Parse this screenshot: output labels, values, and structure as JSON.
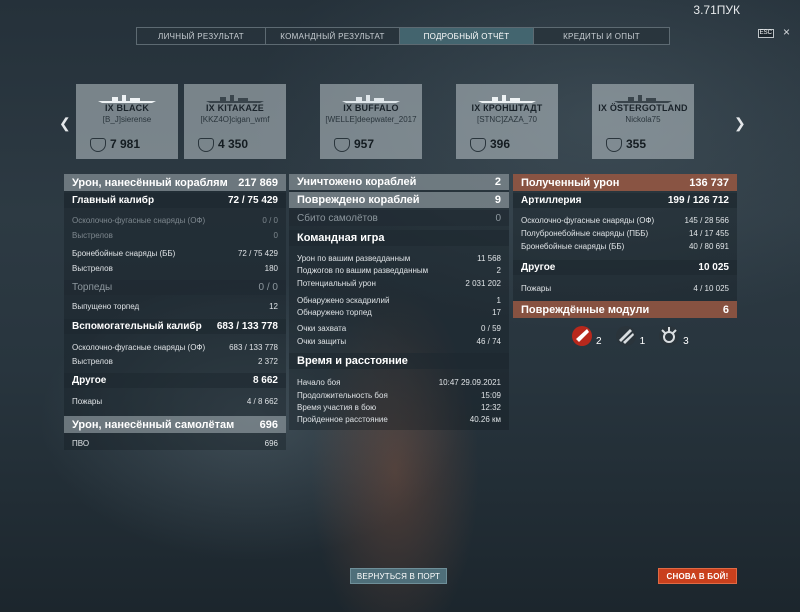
{
  "top_value": "3.71ПУК",
  "tabs": [
    {
      "label": "ЛИЧНЫЙ РЕЗУЛЬТАТ",
      "active": false
    },
    {
      "label": "КОМАНДНЫЙ РЕЗУЛЬТАТ",
      "active": false
    },
    {
      "label": "ПОДРОБНЫЙ ОТЧЁТ",
      "active": true
    },
    {
      "label": "КРЕДИТЫ И ОПЫТ",
      "active": false
    }
  ],
  "esc_label": "ESC",
  "close_symbol": "×",
  "ships": [
    {
      "name": "IX BLACK",
      "player": "[B_J]sierense",
      "score": "7 981"
    },
    {
      "name": "IX KITAKAZE",
      "player": "[KKZ4O]cigan_wmf",
      "score": "4 350"
    },
    {
      "name": "IX BUFFALO",
      "player": "[WELLE]deepwater_2017",
      "score": "957"
    },
    {
      "name": "IX КРОНШТАДТ",
      "player": "[STNC]ZAZA_70",
      "score": "396"
    },
    {
      "name": "IX ÖSTERGOTLAND",
      "player": "Nickola75",
      "score": "355"
    }
  ],
  "left": {
    "damage_ships": {
      "label": "Урон, нанесённый кораблям",
      "value": "217 869"
    },
    "main_caliber": {
      "label": "Главный калибр",
      "value": "72 / 75 429"
    },
    "he_shells": {
      "label": "Осколочно-фугасные снаряды (ОФ)",
      "value": "0 / 0"
    },
    "he_shots": {
      "label": "Выстрелов",
      "value": "0"
    },
    "ap_shells": {
      "label": "Бронебойные снаряды (ББ)",
      "value": "72 / 75 429"
    },
    "ap_shots": {
      "label": "Выстрелов",
      "value": "180"
    },
    "torpedoes": {
      "label": "Торпеды",
      "value": "0 / 0"
    },
    "torpedoes_fired": {
      "label": "Выпущено торпед",
      "value": "12"
    },
    "secondary": {
      "label": "Вспомогательный калибр",
      "value": "683 / 133 778"
    },
    "sec_he": {
      "label": "Осколочно-фугасные снаряды (ОФ)",
      "value": "683 / 133 778"
    },
    "sec_shots": {
      "label": "Выстрелов",
      "value": "2 372"
    },
    "other": {
      "label": "Другое",
      "value": "8 662"
    },
    "fires": {
      "label": "Пожары",
      "value": "4 / 8 662"
    },
    "damage_planes": {
      "label": "Урон, нанесённый самолётам",
      "value": "696"
    },
    "aa": {
      "label": "ПВО",
      "value": "696"
    }
  },
  "middle": {
    "destroyed": {
      "label": "Уничтожено кораблей",
      "value": "2"
    },
    "damaged": {
      "label": "Повреждено кораблей",
      "value": "9"
    },
    "planes": {
      "label": "Сбито самолётов",
      "value": "0"
    },
    "team_header": "Командная игра",
    "team_rows": [
      {
        "label": "Урон по вашим разведданным",
        "value": "11 568"
      },
      {
        "label": "Поджогов по вашим разведданным",
        "value": "2"
      },
      {
        "label": "Потенциальный урон",
        "value": "2 031 202"
      },
      {
        "label": "Обнаружено эскадрилий",
        "value": "1"
      },
      {
        "label": "Обнаружено торпед",
        "value": "17"
      },
      {
        "label": "Очки захвата",
        "value": "0 / 59"
      },
      {
        "label": "Очки защиты",
        "value": "46 / 74"
      }
    ],
    "time_header": "Время и расстояние",
    "time_rows": [
      {
        "label": "Начало боя",
        "value": "10:47  29.09.2021"
      },
      {
        "label": "Продолжительность боя",
        "value": "15:09"
      },
      {
        "label": "Время участия в бою",
        "value": "12:32"
      },
      {
        "label": "Пройденное расстояние",
        "value": "40.26 км"
      }
    ]
  },
  "right": {
    "received": {
      "label": "Полученный урон",
      "value": "136 737"
    },
    "artillery": {
      "label": "Артиллерия",
      "value": "199 / 126 712"
    },
    "art_rows": [
      {
        "label": "Осколочно-фугасные снаряды (ОФ)",
        "value": "145 / 28 566"
      },
      {
        "label": "Полубронебойные снаряды (ПББ)",
        "value": "14 / 17 455"
      },
      {
        "label": "Бронебойные снаряды (ББ)",
        "value": "40 / 80 691"
      }
    ],
    "other": {
      "label": "Другое",
      "value": "10 025"
    },
    "fires": {
      "label": "Пожары",
      "value": "4 / 10 025"
    },
    "modules": {
      "label": "Повреждённые модули",
      "value": "6"
    },
    "module_counts": [
      {
        "icon": "engine-damage-icon",
        "count": "2"
      },
      {
        "icon": "torpedo-tube-icon",
        "count": "1"
      },
      {
        "icon": "aa-gun-icon",
        "count": "3"
      }
    ]
  },
  "buttons": {
    "port": "ВЕРНУТЬСЯ В ПОРТ",
    "battle": "СНОВА В БОЙ!"
  }
}
